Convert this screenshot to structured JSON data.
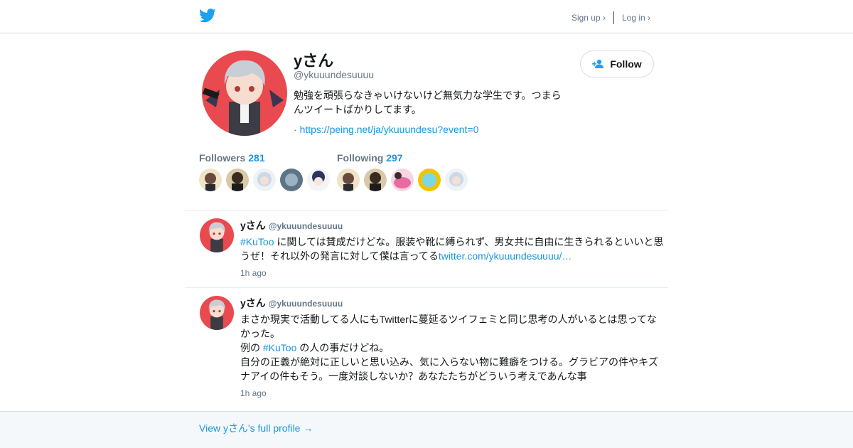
{
  "colors": {
    "brand": "#1da1f2",
    "link": "#1b95e0",
    "muted": "#657786",
    "text": "#14171a",
    "footer_bg": "#f5f8fa"
  },
  "header": {
    "logo_icon": "twitter-bird-icon",
    "signup_label": "Sign up ›",
    "login_label": "Log in ›"
  },
  "profile": {
    "name": "yさん",
    "handle": "@ykuuundesuuuu",
    "bio": "勉強を頑張らなきゃいけないけど無気力な学生です。つまらんツイートばかりしてます。",
    "url_prefix": "·",
    "url": "https://peing.net/ja/ykuuundesu?event=0",
    "follow_label": "Follow",
    "followers_label": "Followers",
    "followers_count": "281",
    "following_label": "Following",
    "following_count": "297"
  },
  "tweets": [
    {
      "name": "yさん",
      "handle": "@ykuuundesuuuu",
      "hashtag": "#KuToo",
      "text_after_hashtag": " に関しては賛成だけどな。服装や靴に縛られず、男女共に自由に生きられるといいと思うぜ！それ以外の発言に対して僕は言ってる",
      "link": "twitter.com/ykuuundesuuuu/…",
      "time": "1h ago"
    },
    {
      "name": "yさん",
      "handle": "@ykuuundesuuuu",
      "line1": "まさか現実で活動してる人にもTwitterに蔓延るツイフェミと同じ思考の人がいるとは思ってなかった。",
      "line2_before": "例の ",
      "hashtag": "#KuToo",
      "line2_after": " の人の事だけどね。",
      "line3": "自分の正義が絶対に正しいと思い込み、気に入らない物に難癖をつける。グラビアの件やキズナアイの件もそう。一度対談しないか？あなたたちがどういう考えであんな事",
      "time": "1h ago"
    }
  ],
  "footer": {
    "link_label": "View yさん's full profile →"
  }
}
